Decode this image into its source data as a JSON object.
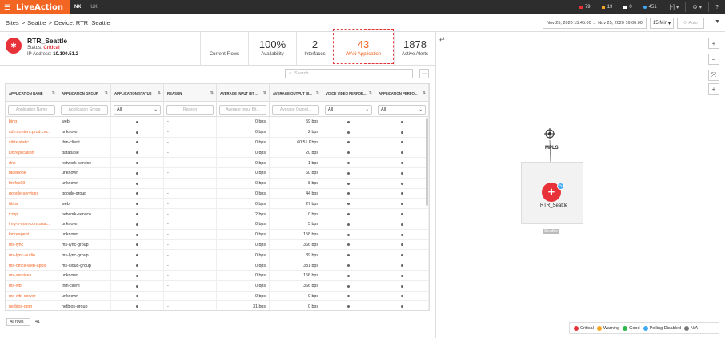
{
  "nav": {
    "logo": "LiveAction",
    "tabs": [
      "NX",
      "UX"
    ],
    "stats": [
      {
        "count": "79",
        "color": "#e8323a"
      },
      {
        "count": "19",
        "color": "#f5a623"
      },
      {
        "count": "0",
        "color": "#ffffff"
      },
      {
        "count": "451",
        "color": "#3fa9f5"
      }
    ],
    "user_menu": "[-] ▾",
    "settings": "⚙ ▾",
    "help": "?"
  },
  "breadcrumb": {
    "items": [
      "Sites",
      ">",
      "Seattle",
      ">",
      "Device: RTR_Seattle"
    ]
  },
  "toolbar": {
    "time_range": "Nov 25, 2020 15:45:00 → Nov 25, 2020 16:00:00",
    "interval": "15 Min",
    "auto": "Auto"
  },
  "device": {
    "name": "RTR_Seattle",
    "status_label": "Status:",
    "status_value": "Critical",
    "ip_label": "IP Address:",
    "ip_value": "10.100.51.2"
  },
  "kpis": {
    "current_flows_label": "Current Flows",
    "availability_value": "100%",
    "availability_label": "Availability",
    "interfaces_value": "2",
    "interfaces_label": "Interfaces",
    "wan_value": "43",
    "wan_label": "WAN Application",
    "alerts_value": "1878",
    "alerts_label": "Active Alerts"
  },
  "search": {
    "placeholder": "Search..."
  },
  "table": {
    "headers": [
      "APPLICATION NAME",
      "APPLICATION GROUP",
      "APPLICATION STATUS",
      "REASON",
      "AVERAGE INPUT BIT ...",
      "AVERAGE OUTPUT BI...",
      "VOICE VIDEO PERFOR...",
      "APPLICATION PERFO..."
    ],
    "filters": {
      "name": "Application Name",
      "group": "Application Group",
      "status": "All",
      "reason": "Reason",
      "input": "Average Input Bit...",
      "output": "Average Output...",
      "voice": "All",
      "perf": "All"
    },
    "rows": [
      [
        "bing",
        "web",
        "-",
        "0 bps",
        "59 bps"
      ],
      [
        "cdn.content.prod.cm...",
        "unknown",
        "-",
        "0 bps",
        "2 bps"
      ],
      [
        "citrix-static",
        "thin-client",
        "-",
        "0 bps",
        "60.51 Kbps"
      ],
      [
        "DBreplication",
        "database",
        "-",
        "0 bps",
        "20 bps"
      ],
      [
        "dns",
        "network-service",
        "-",
        "0 bps",
        "1 bps"
      ],
      [
        "facebook",
        "unknown",
        "-",
        "0 bps",
        "60 bps"
      ],
      [
        "firefox99",
        "unknown",
        "-",
        "0 bps",
        "8 bps"
      ],
      [
        "google-services",
        "google-group",
        "-",
        "0 bps",
        "44 bps"
      ],
      [
        "https",
        "web",
        "-",
        "0 bps",
        "27 bps"
      ],
      [
        "icmp",
        "network-service",
        "-",
        "2 bps",
        "0 bps"
      ],
      [
        "img-s-msn-com.aka...",
        "unknown",
        "-",
        "0 bps",
        "5 bps"
      ],
      [
        "lanreagent",
        "unknown",
        "-",
        "0 bps",
        "158 bps"
      ],
      [
        "ms-lync",
        "ms-lync-group",
        "-",
        "0 bps",
        "366 bps"
      ],
      [
        "ms-lync-audio",
        "ms-lync-group",
        "-",
        "0 bps",
        "39 bps"
      ],
      [
        "ms-office-web-apps",
        "ms-cloud-group",
        "-",
        "0 bps",
        "381 bps"
      ],
      [
        "ms-services",
        "unknown",
        "-",
        "0 bps",
        "156 bps"
      ],
      [
        "ms-wbt",
        "thin-client",
        "-",
        "0 bps",
        "366 bps"
      ],
      [
        "ms-wbt-server",
        "unknown",
        "-",
        "0 bps",
        "0 bps"
      ],
      [
        "netbios-dgm",
        "netbios-group",
        "-",
        "31 bps",
        "0 bps"
      ]
    ]
  },
  "footer": {
    "rows_select": "All rows",
    "row_count": "41"
  },
  "topology": {
    "mpls_label": "MPLS",
    "router_label": "RTR_Seattle",
    "site_label": "Seattle"
  },
  "legend": {
    "critical": "Critical",
    "warning": "Warning",
    "good": "Good",
    "polling_disabled": "Polling Disabled",
    "na": "N/A"
  }
}
